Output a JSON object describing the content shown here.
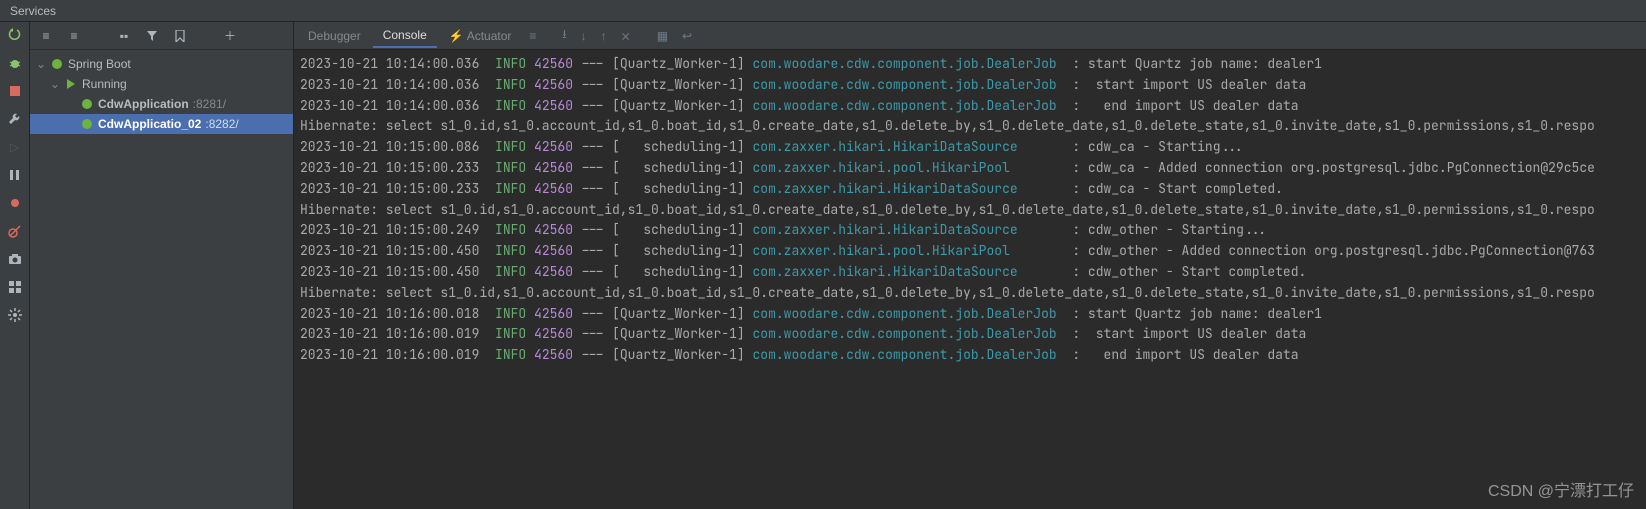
{
  "panel": {
    "title": "Services"
  },
  "tree": {
    "root": "Spring Boot",
    "running": "Running",
    "apps": [
      {
        "name": "CdwApplication",
        "port": ":8281/"
      },
      {
        "name": "CdwApplicatio_02",
        "port": ":8282/"
      }
    ]
  },
  "tabs": {
    "debugger": "Debugger",
    "console": "Console",
    "actuator": "Actuator"
  },
  "colors": {
    "info": "#6aab73",
    "pid": "#b888d5",
    "class": "#3c9aa8",
    "selection": "#4b6eaf"
  },
  "console": {
    "lines": [
      {
        "ts": "2023-10-21 10:14:00.036",
        "lvl": "INFO",
        "pid": "42560",
        "thr": "[Quartz_Worker-1]",
        "cls": "com.woodare.cdw.component.job.DealerJob",
        "msg": ": start Quartz job name: dealer1"
      },
      {
        "ts": "2023-10-21 10:14:00.036",
        "lvl": "INFO",
        "pid": "42560",
        "thr": "[Quartz_Worker-1]",
        "cls": "com.woodare.cdw.component.job.DealerJob",
        "msg": ":  start import US dealer data"
      },
      {
        "ts": "2023-10-21 10:14:00.036",
        "lvl": "INFO",
        "pid": "42560",
        "thr": "[Quartz_Worker-1]",
        "cls": "com.woodare.cdw.component.job.DealerJob",
        "msg": ":   end import US dealer data"
      },
      {
        "raw": "Hibernate: select s1_0.id,s1_0.account_id,s1_0.boat_id,s1_0.create_date,s1_0.delete_by,s1_0.delete_date,s1_0.delete_state,s1_0.invite_date,s1_0.permissions,s1_0.respo"
      },
      {
        "ts": "2023-10-21 10:15:00.086",
        "lvl": "INFO",
        "pid": "42560",
        "thr": "[   scheduling-1]",
        "cls": "com.zaxxer.hikari.HikariDataSource",
        "msg": ": cdw_ca - Starting..."
      },
      {
        "ts": "2023-10-21 10:15:00.233",
        "lvl": "INFO",
        "pid": "42560",
        "thr": "[   scheduling-1]",
        "cls": "com.zaxxer.hikari.pool.HikariPool",
        "msg": ": cdw_ca - Added connection org.postgresql.jdbc.PgConnection@29c5ce"
      },
      {
        "ts": "2023-10-21 10:15:00.233",
        "lvl": "INFO",
        "pid": "42560",
        "thr": "[   scheduling-1]",
        "cls": "com.zaxxer.hikari.HikariDataSource",
        "msg": ": cdw_ca - Start completed."
      },
      {
        "raw": "Hibernate: select s1_0.id,s1_0.account_id,s1_0.boat_id,s1_0.create_date,s1_0.delete_by,s1_0.delete_date,s1_0.delete_state,s1_0.invite_date,s1_0.permissions,s1_0.respo"
      },
      {
        "ts": "2023-10-21 10:15:00.249",
        "lvl": "INFO",
        "pid": "42560",
        "thr": "[   scheduling-1]",
        "cls": "com.zaxxer.hikari.HikariDataSource",
        "msg": ": cdw_other - Starting..."
      },
      {
        "ts": "2023-10-21 10:15:00.450",
        "lvl": "INFO",
        "pid": "42560",
        "thr": "[   scheduling-1]",
        "cls": "com.zaxxer.hikari.pool.HikariPool",
        "msg": ": cdw_other - Added connection org.postgresql.jdbc.PgConnection@763"
      },
      {
        "ts": "2023-10-21 10:15:00.450",
        "lvl": "INFO",
        "pid": "42560",
        "thr": "[   scheduling-1]",
        "cls": "com.zaxxer.hikari.HikariDataSource",
        "msg": ": cdw_other - Start completed."
      },
      {
        "raw": "Hibernate: select s1_0.id,s1_0.account_id,s1_0.boat_id,s1_0.create_date,s1_0.delete_by,s1_0.delete_date,s1_0.delete_state,s1_0.invite_date,s1_0.permissions,s1_0.respo"
      },
      {
        "ts": "2023-10-21 10:16:00.018",
        "lvl": "INFO",
        "pid": "42560",
        "thr": "[Quartz_Worker-1]",
        "cls": "com.woodare.cdw.component.job.DealerJob",
        "msg": ": start Quartz job name: dealer1"
      },
      {
        "ts": "2023-10-21 10:16:00.019",
        "lvl": "INFO",
        "pid": "42560",
        "thr": "[Quartz_Worker-1]",
        "cls": "com.woodare.cdw.component.job.DealerJob",
        "msg": ":  start import US dealer data"
      },
      {
        "ts": "2023-10-21 10:16:00.019",
        "lvl": "INFO",
        "pid": "42560",
        "thr": "[Quartz_Worker-1]",
        "cls": "com.woodare.cdw.component.job.DealerJob",
        "msg": ":   end import US dealer data"
      }
    ]
  },
  "watermark": "CSDN @宁漂打工仔"
}
